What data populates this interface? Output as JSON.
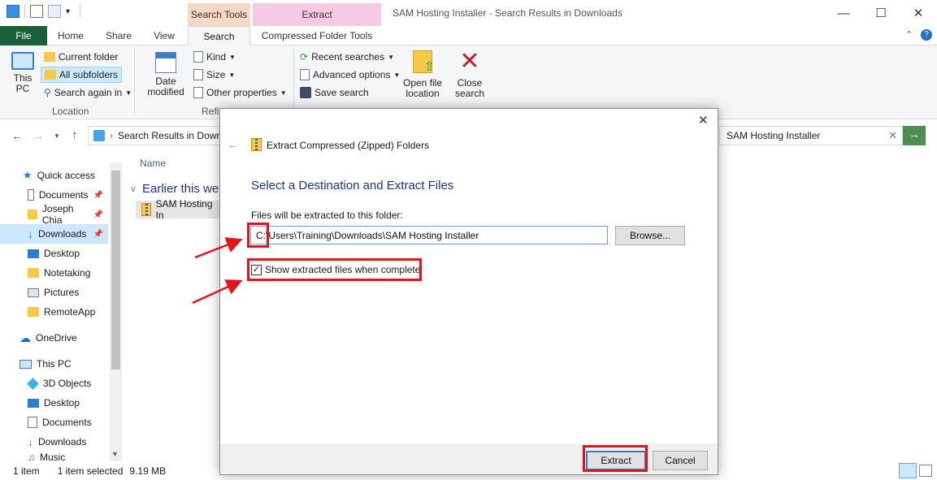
{
  "window": {
    "title": "SAM Hosting Installer - Search Results in Downloads",
    "context_search": "Search Tools",
    "context_extract": "Extract",
    "minimize_icon": "minimize-icon",
    "maximize_icon": "maximize-icon",
    "close_icon": "close-icon"
  },
  "tabs": {
    "file": "File",
    "home": "Home",
    "share": "Share",
    "view": "View",
    "search": "Search",
    "compressed": "Compressed Folder Tools"
  },
  "ribbon": {
    "this_pc_1": "This",
    "this_pc_2": "PC",
    "current_folder": "Current folder",
    "all_subfolders": "All subfolders",
    "search_again": "Search again in",
    "location_label": "Location",
    "date_modified_1": "Date",
    "date_modified_2": "modified",
    "kind": "Kind",
    "size": "Size",
    "other_properties": "Other properties",
    "refine_label": "Refi",
    "recent_searches": "Recent searches",
    "advanced_options": "Advanced options",
    "save_search": "Save search",
    "open_file_location_1": "Open file",
    "open_file_location_2": "location",
    "close_search_1": "Close",
    "close_search_2": "search"
  },
  "address": {
    "path": "Search Results in Down",
    "search_value": "SAM Hosting Installer"
  },
  "nav": {
    "items": [
      {
        "label": "Quick access"
      },
      {
        "label": "Documents"
      },
      {
        "label": "Joseph Chia"
      },
      {
        "label": "Downloads"
      },
      {
        "label": "Desktop"
      },
      {
        "label": "Notetaking"
      },
      {
        "label": "Pictures"
      },
      {
        "label": "RemoteApp"
      },
      {
        "label": "OneDrive"
      },
      {
        "label": "This PC"
      },
      {
        "label": "3D Objects"
      },
      {
        "label": "Desktop"
      },
      {
        "label": "Documents"
      },
      {
        "label": "Downloads"
      },
      {
        "label": "Music"
      }
    ]
  },
  "content": {
    "column_name": "Name",
    "group_title": "Earlier this wee",
    "file_name": "SAM Hosting In"
  },
  "status": {
    "count": "1 item",
    "selected": "1 item selected",
    "size": "9.19 MB"
  },
  "dialog": {
    "title": "Extract Compressed (Zipped) Folders",
    "heading": "Select a Destination and Extract Files",
    "folder_label": "Files will be extracted to this folder:",
    "path_value": "C:\\Users\\Training\\Downloads\\SAM Hosting Installer",
    "browse": "Browse...",
    "show_files": "Show extracted files when complete",
    "show_files_checked": true,
    "extract": "Extract",
    "cancel": "Cancel"
  },
  "colors": {
    "file_tab": "#1b5e3a",
    "search_context": "#f7d8c4",
    "extract_context": "#f8c9e2",
    "annotation_red": "#e3121b",
    "dialog_heading": "#1e3287",
    "selection": "#cce8ff"
  }
}
